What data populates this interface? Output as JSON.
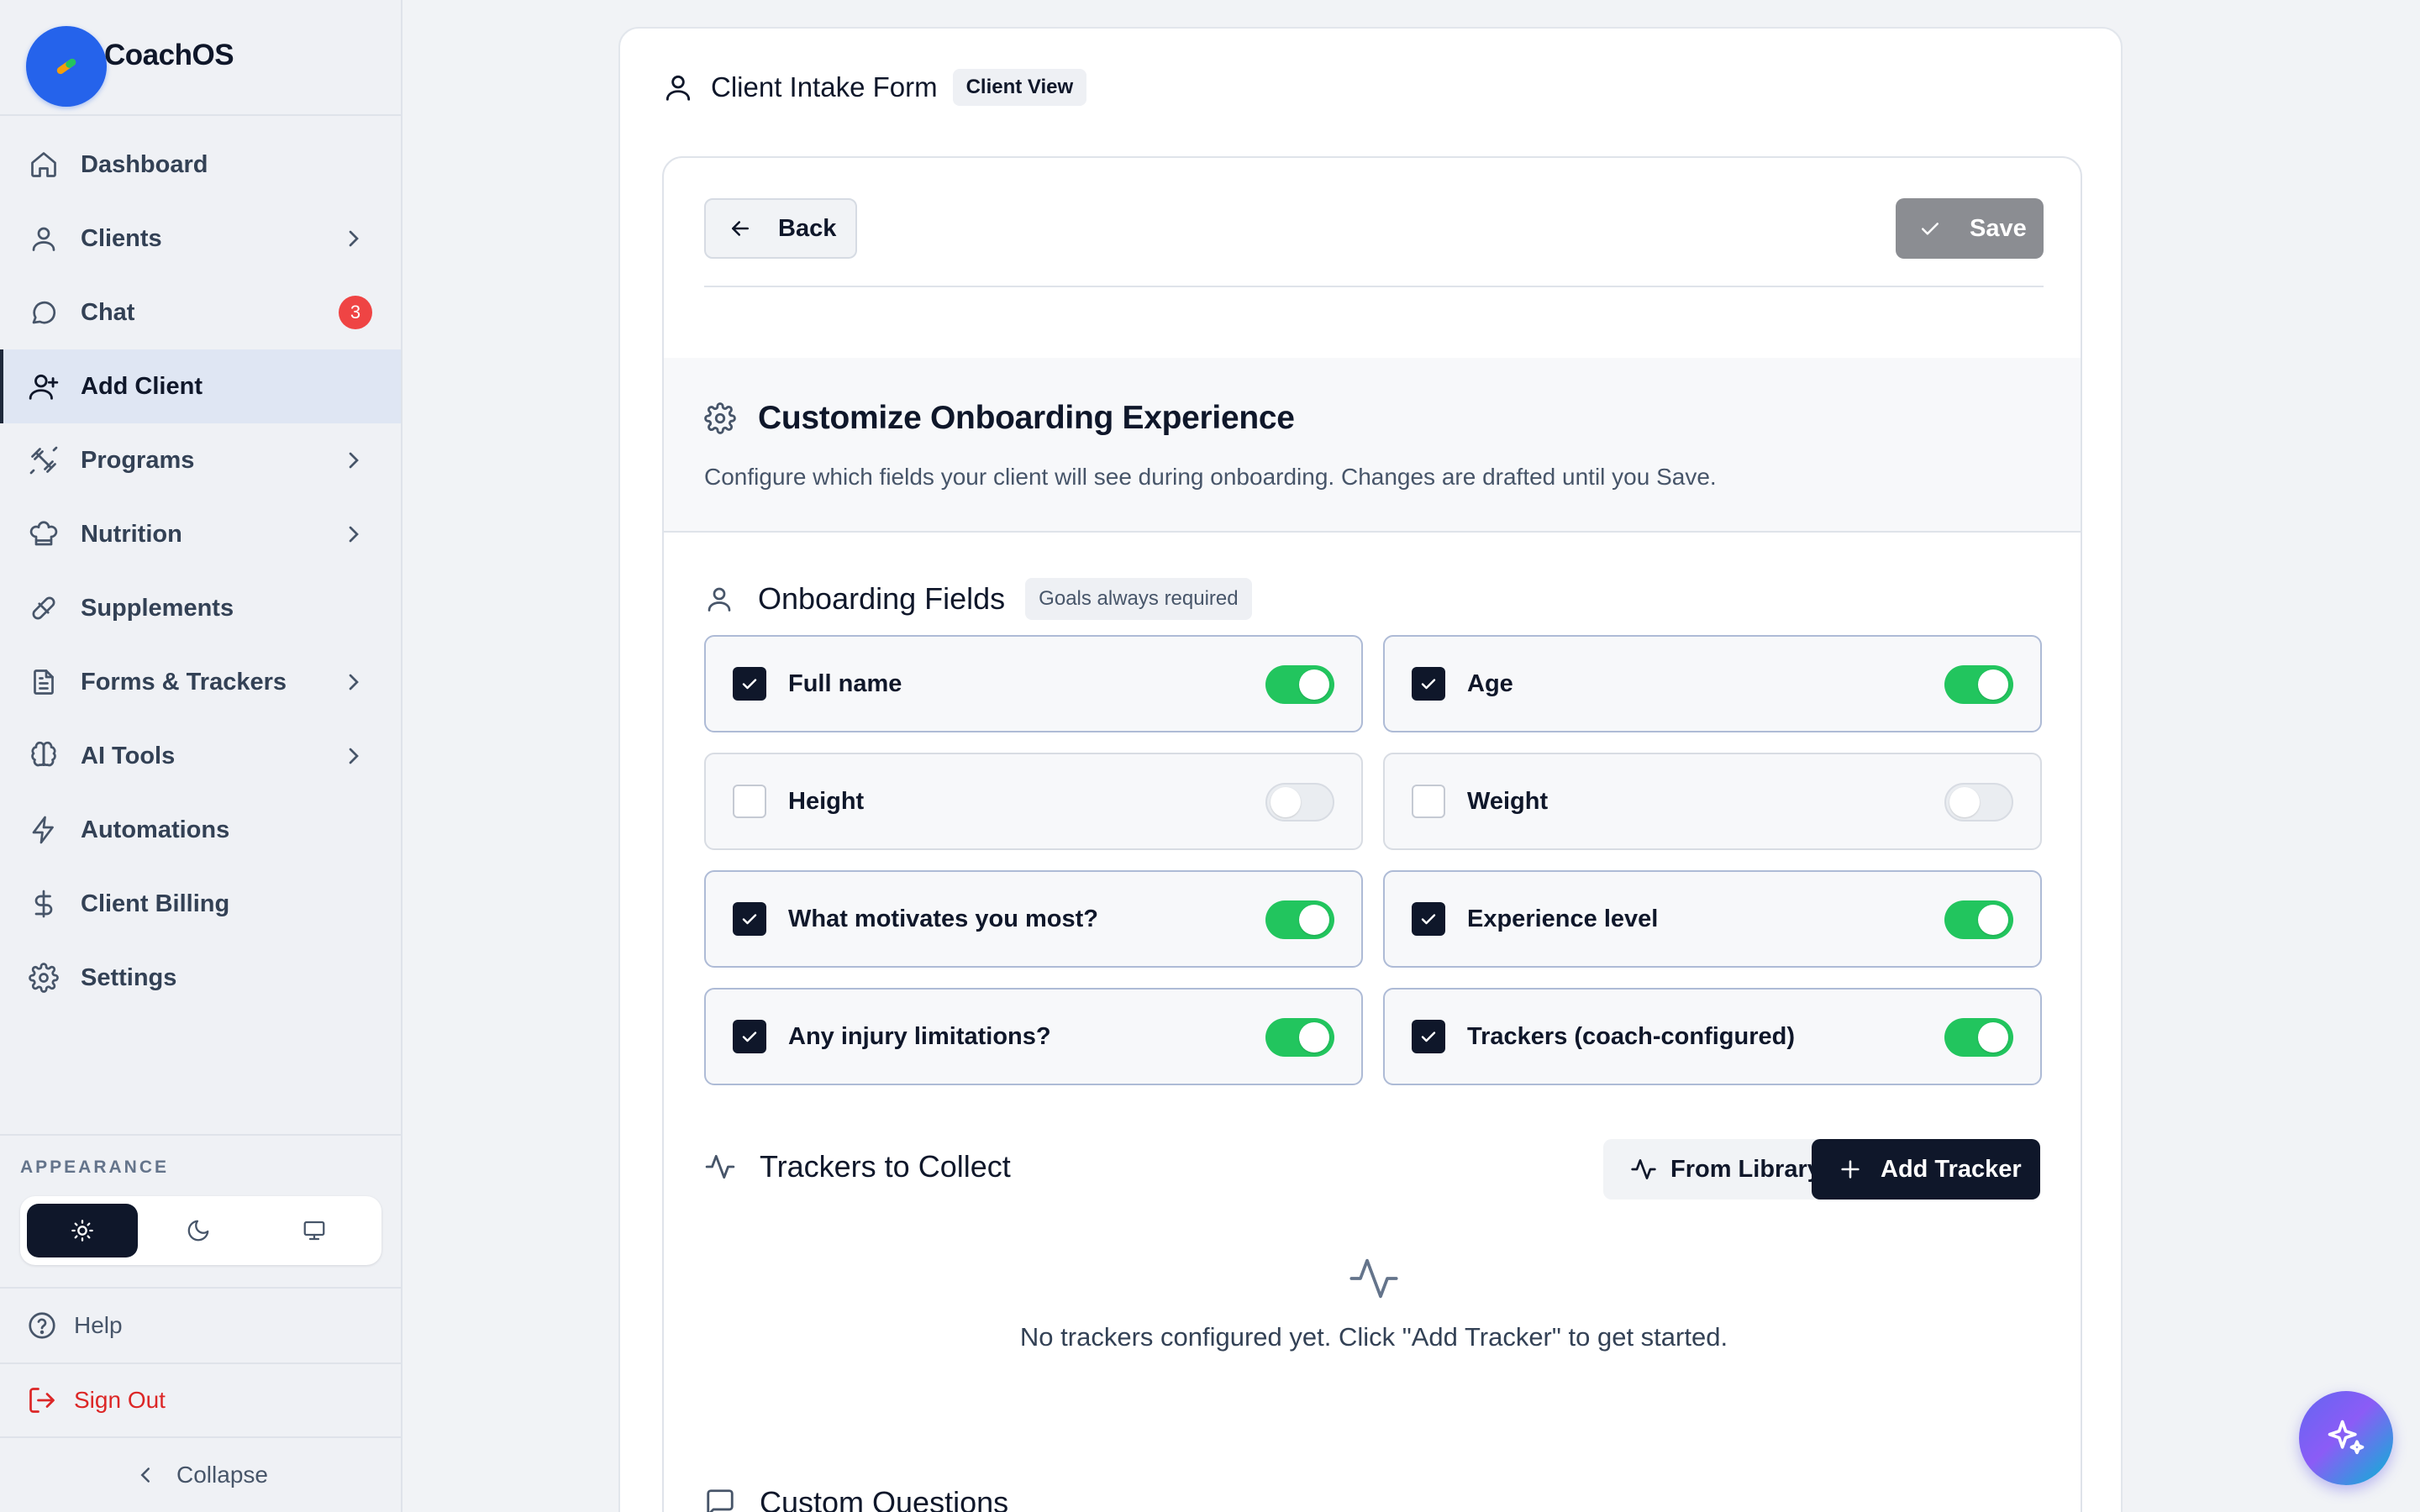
{
  "brand": {
    "name": "CoachOS",
    "logo_icon": "pill-icon"
  },
  "sidebar": {
    "items": [
      {
        "label": "Dashboard",
        "icon": "home-icon",
        "chevron": false
      },
      {
        "label": "Clients",
        "icon": "user-icon",
        "chevron": true
      },
      {
        "label": "Chat",
        "icon": "chat-icon",
        "chevron": false,
        "badge": "3"
      },
      {
        "label": "Add Client",
        "icon": "user-plus-icon",
        "chevron": false,
        "active": true
      },
      {
        "label": "Programs",
        "icon": "dumbbell-icon",
        "chevron": true
      },
      {
        "label": "Nutrition",
        "icon": "chef-hat-icon",
        "chevron": true
      },
      {
        "label": "Supplements",
        "icon": "pill-icon",
        "chevron": false
      },
      {
        "label": "Forms & Trackers",
        "icon": "file-text-icon",
        "chevron": true
      },
      {
        "label": "AI Tools",
        "icon": "brain-icon",
        "chevron": true
      },
      {
        "label": "Automations",
        "icon": "bolt-icon",
        "chevron": false
      },
      {
        "label": "Client Billing",
        "icon": "dollar-icon",
        "chevron": false
      },
      {
        "label": "Settings",
        "icon": "gear-icon",
        "chevron": false
      }
    ],
    "appearance_label": "APPEARANCE",
    "theme_options": [
      "light",
      "dark",
      "system"
    ],
    "theme_selected": "light",
    "help_label": "Help",
    "signout_label": "Sign Out",
    "collapse_label": "Collapse"
  },
  "page": {
    "title": "Client Intake Form",
    "view_badge": "Client View",
    "back_label": "Back",
    "save_label": "Save"
  },
  "customize": {
    "title": "Customize Onboarding Experience",
    "description": "Configure which fields your client will see during onboarding. Changes are drafted until you Save."
  },
  "onboarding": {
    "title": "Onboarding Fields",
    "badge": "Goals always required",
    "fields": [
      {
        "label": "Full name",
        "enabled": true
      },
      {
        "label": "Age",
        "enabled": true
      },
      {
        "label": "Height",
        "enabled": false
      },
      {
        "label": "Weight",
        "enabled": false
      },
      {
        "label": "What motivates you most?",
        "enabled": true
      },
      {
        "label": "Experience level",
        "enabled": true
      },
      {
        "label": "Any injury limitations?",
        "enabled": true
      },
      {
        "label": "Trackers (coach-configured)",
        "enabled": true
      }
    ]
  },
  "trackers": {
    "title": "Trackers to Collect",
    "from_library_label": "From Library",
    "add_tracker_label": "Add Tracker",
    "empty_text": "No trackers configured yet. Click \"Add Tracker\" to get started."
  },
  "custom_questions": {
    "title": "Custom Questions"
  },
  "colors": {
    "accent": "#0f172a",
    "toggle_on": "#22c55e",
    "badge": "#ef4444",
    "brand_blue": "#2563eb",
    "danger": "#dc2626"
  }
}
